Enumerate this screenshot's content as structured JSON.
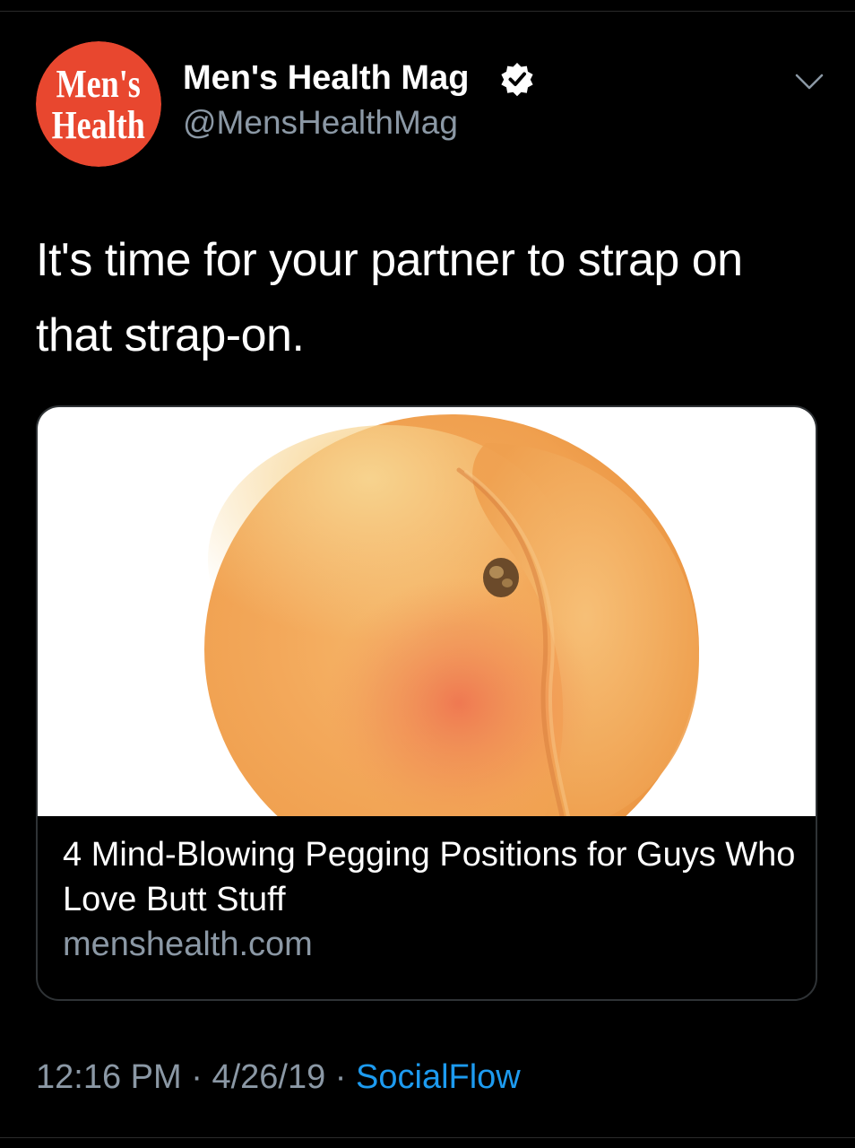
{
  "account": {
    "display_name": "Men's Health Mag",
    "handle": "@MensHealthMag",
    "verified": true,
    "avatar_logo_line1": "Men's",
    "avatar_logo_line2": "Health",
    "avatar_color": "#e8472f"
  },
  "tweet": {
    "text": "It's time for your partner to strap on that strap-on."
  },
  "card": {
    "image": "peach-image",
    "title": "4 Mind-Blowing Pegging Positions for Guys Who Love Butt Stuff",
    "domain": "menshealth.com"
  },
  "meta": {
    "time": "12:16 PM",
    "separator1": " · ",
    "date": "4/26/19",
    "separator2": " · ",
    "source": "SocialFlow"
  },
  "icons": {
    "verified": "verified-badge-icon",
    "menu": "chevron-down-icon"
  },
  "colors": {
    "background": "#000000",
    "secondary_text": "#8b98a5",
    "link": "#1d9bf0"
  }
}
